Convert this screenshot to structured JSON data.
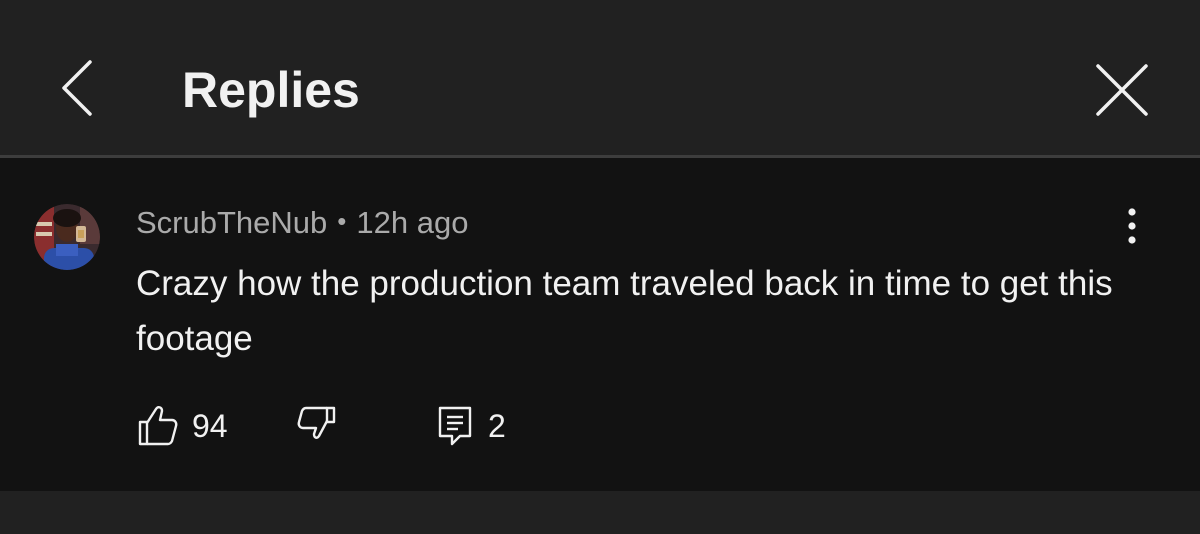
{
  "header": {
    "title": "Replies",
    "back_icon": "chevron-left-icon",
    "close_icon": "close-icon"
  },
  "comment": {
    "author": "ScrubTheNub",
    "separator": "•",
    "timestamp": "12h ago",
    "text": "Crazy how the production team traveled back in time to get this footage",
    "more_icon": "more-vertical-icon",
    "like_count": "94",
    "reply_count": "2",
    "like_icon": "thumbs-up-icon",
    "dislike_icon": "thumbs-down-icon",
    "reply_icon": "reply-icon"
  },
  "colors": {
    "background": "#212121",
    "comment_background": "#121212",
    "primary_text": "#f1f1f1",
    "secondary_text": "#aaaaaa",
    "divider": "#3d3d3d"
  }
}
